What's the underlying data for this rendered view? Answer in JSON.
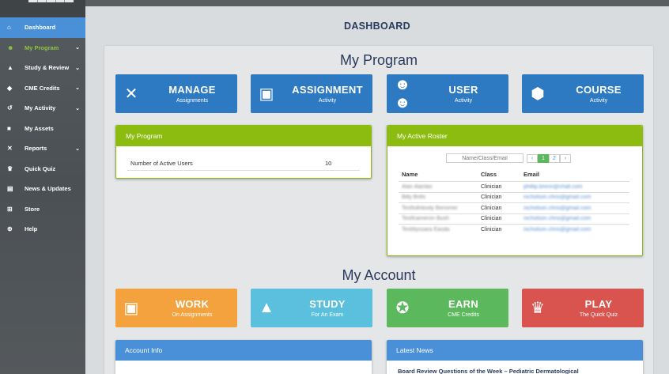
{
  "sidebar": {
    "items": [
      {
        "label": "Dashboard",
        "icon": "home-icon",
        "glyph": "⌂",
        "chevron": false,
        "state": "active"
      },
      {
        "label": "My Program",
        "icon": "users-icon",
        "glyph": "☻",
        "chevron": true,
        "state": "current"
      },
      {
        "label": "Study & Review",
        "icon": "graduation-cap-icon",
        "glyph": "▲",
        "chevron": true,
        "state": ""
      },
      {
        "label": "CME Credits",
        "icon": "certificate-icon",
        "glyph": "◆",
        "chevron": true,
        "state": ""
      },
      {
        "label": "My Activity",
        "icon": "history-icon",
        "glyph": "↺",
        "chevron": true,
        "state": ""
      },
      {
        "label": "My Assets",
        "icon": "folder-icon",
        "glyph": "■",
        "chevron": false,
        "state": ""
      },
      {
        "label": "Reports",
        "icon": "tools-icon",
        "glyph": "✕",
        "chevron": true,
        "state": ""
      },
      {
        "label": "Quick Quiz",
        "icon": "trophy-icon",
        "glyph": "♛",
        "chevron": false,
        "state": ""
      },
      {
        "label": "News & Updates",
        "icon": "newspaper-icon",
        "glyph": "▤",
        "chevron": false,
        "state": ""
      },
      {
        "label": "Store",
        "icon": "cart-icon",
        "glyph": "⊞",
        "chevron": false,
        "state": ""
      },
      {
        "label": "Help",
        "icon": "life-ring-icon",
        "glyph": "⊕",
        "chevron": false,
        "state": ""
      }
    ]
  },
  "header": {
    "title": "DASHBOARD"
  },
  "program": {
    "title": "My Program",
    "tiles": [
      {
        "big": "MANAGE",
        "small": "Assignments",
        "icon": "tools-icon",
        "glyph": "✕"
      },
      {
        "big": "ASSIGNMENT",
        "small": "Activity",
        "icon": "calendar-icon",
        "glyph": "▣"
      },
      {
        "big": "USER",
        "small": "Activity",
        "icon": "users-icon",
        "glyph": "☻☻"
      },
      {
        "big": "COURSE",
        "small": "Activity",
        "icon": "cube-icon",
        "glyph": "⬢"
      }
    ],
    "card": {
      "title": "My Program",
      "active_users_label": "Number of Active Users",
      "active_users_value": "10"
    }
  },
  "roster": {
    "title": "My Active Roster",
    "search_placeholder": "Name/Class/Email",
    "pager": {
      "prev": "‹",
      "pages": [
        "1",
        "2"
      ],
      "next": "›",
      "current": "1"
    },
    "columns": [
      "Name",
      "Class",
      "Email"
    ],
    "rows": [
      {
        "name": "Alan Alanlas",
        "class": "Clinician",
        "email": "phillip.brenn@chall.com"
      },
      {
        "name": "Billy Brills",
        "class": "Clinician",
        "email": "nicholson.chris@gmail.com"
      },
      {
        "name": "Testfullnbody Bensmer",
        "class": "Clinician",
        "email": "nicholson.chris@gmail.com"
      },
      {
        "name": "Testfcameron Bush",
        "class": "Clinician",
        "email": "nicholson.chris@gmail.com"
      },
      {
        "name": "Testtilyssara Easda",
        "class": "Clinician",
        "email": "nicholson.chris@gmail.com"
      }
    ]
  },
  "account": {
    "title": "My Account",
    "tiles": [
      {
        "big": "WORK",
        "small": "On Assignments",
        "icon": "calendar-icon",
        "glyph": "▣",
        "color": "orange"
      },
      {
        "big": "STUDY",
        "small": "For An Exam",
        "icon": "graduation-cap-icon",
        "glyph": "▲",
        "color": "cyan"
      },
      {
        "big": "EARN",
        "small": "CME Credits",
        "icon": "award-icon",
        "glyph": "✪",
        "color": "green"
      },
      {
        "big": "PLAY",
        "small": "The Quick Quiz",
        "icon": "trophy-icon",
        "glyph": "♛",
        "color": "red"
      }
    ],
    "info_title": "Account Info",
    "news_title": "Latest News",
    "news_headline": "Board Review Questions of the Week – Pediatric Dermatological"
  }
}
